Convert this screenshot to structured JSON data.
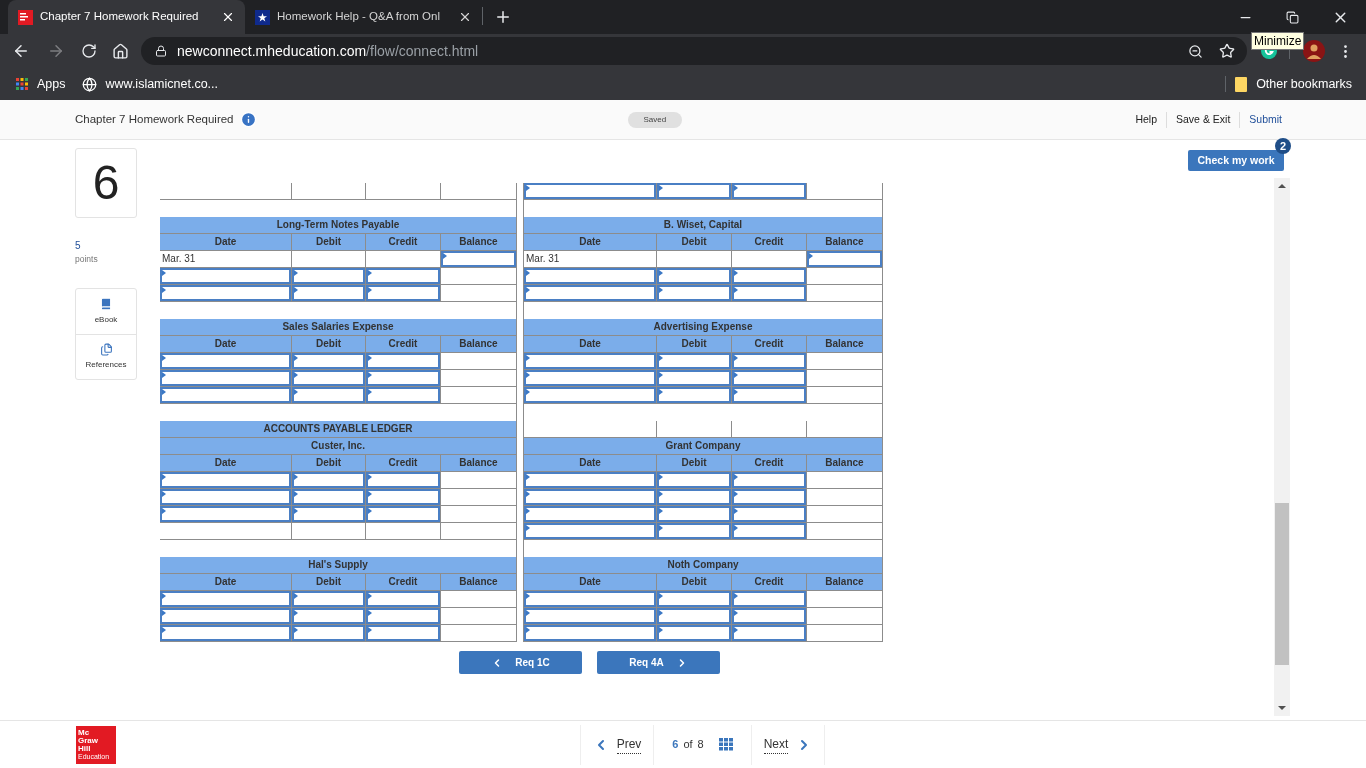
{
  "browser": {
    "tabs": [
      {
        "title": "Chapter 7 Homework Required",
        "selected": true,
        "kind": "mh"
      },
      {
        "title": "Homework Help - Q&A from Onl",
        "selected": false,
        "kind": "star"
      }
    ],
    "url_host": "newconnect.mheducation.com",
    "url_path": "/flow/connect.html",
    "bookmarks": [
      {
        "label": "Apps",
        "kind": "apps"
      },
      {
        "label": "www.islamicnet.co...",
        "kind": "globe"
      }
    ],
    "other_bookmarks": "Other bookmarks",
    "tooltip": "Minimize"
  },
  "header": {
    "title": "Chapter 7 Homework Required",
    "status": "Saved",
    "links": [
      {
        "label": "Help",
        "kind": "plain"
      },
      {
        "label": "Save & Exit",
        "kind": "plain"
      },
      {
        "label": "Submit",
        "kind": "primary"
      }
    ]
  },
  "question": {
    "number": "6",
    "points": "5",
    "points_label": "points",
    "tools": [
      {
        "label": "eBook",
        "kind": "book"
      },
      {
        "label": "References",
        "kind": "copy"
      }
    ]
  },
  "check_my_work": {
    "label": "Check my work",
    "badge": "2"
  },
  "ledger": {
    "left": [
      {
        "kind": "entry",
        "cells": [
          {
            "kind": "plain"
          },
          {
            "kind": "plain"
          },
          {
            "kind": "plain"
          },
          {
            "kind": "plain"
          }
        ]
      },
      {
        "kind": "gap"
      },
      {
        "kind": "title",
        "text": "Long-Term Notes Payable"
      },
      {
        "kind": "columns",
        "labels": [
          "Date",
          "Debit",
          "Credit",
          "Balance"
        ]
      },
      {
        "kind": "entry",
        "cells": [
          {
            "kind": "text",
            "text": "Mar. 31"
          },
          {
            "kind": "plain"
          },
          {
            "kind": "plain"
          },
          {
            "kind": "input"
          }
        ]
      },
      {
        "kind": "entry",
        "cells": [
          {
            "kind": "input"
          },
          {
            "kind": "input"
          },
          {
            "kind": "input"
          },
          {
            "kind": "plain"
          }
        ]
      },
      {
        "kind": "entry",
        "cells": [
          {
            "kind": "input"
          },
          {
            "kind": "input"
          },
          {
            "kind": "input"
          },
          {
            "kind": "plain"
          }
        ]
      },
      {
        "kind": "gap"
      },
      {
        "kind": "title",
        "text": "Sales Salaries Expense"
      },
      {
        "kind": "columns",
        "labels": [
          "Date",
          "Debit",
          "Credit",
          "Balance"
        ]
      },
      {
        "kind": "entry",
        "cells": [
          {
            "kind": "input"
          },
          {
            "kind": "input"
          },
          {
            "kind": "input"
          },
          {
            "kind": "plain"
          }
        ]
      },
      {
        "kind": "entry",
        "cells": [
          {
            "kind": "input"
          },
          {
            "kind": "input"
          },
          {
            "kind": "input"
          },
          {
            "kind": "plain"
          }
        ]
      },
      {
        "kind": "entry",
        "cells": [
          {
            "kind": "input"
          },
          {
            "kind": "input"
          },
          {
            "kind": "input"
          },
          {
            "kind": "plain"
          }
        ]
      },
      {
        "kind": "gap"
      },
      {
        "kind": "title",
        "text": "ACCOUNTS PAYABLE LEDGER"
      },
      {
        "kind": "title",
        "text": "Custer, Inc."
      },
      {
        "kind": "columns",
        "labels": [
          "Date",
          "Debit",
          "Credit",
          "Balance"
        ]
      },
      {
        "kind": "entry",
        "cells": [
          {
            "kind": "input"
          },
          {
            "kind": "input"
          },
          {
            "kind": "input"
          },
          {
            "kind": "plain"
          }
        ]
      },
      {
        "kind": "entry",
        "cells": [
          {
            "kind": "input"
          },
          {
            "kind": "input"
          },
          {
            "kind": "input"
          },
          {
            "kind": "plain"
          }
        ]
      },
      {
        "kind": "entry",
        "cells": [
          {
            "kind": "input"
          },
          {
            "kind": "input"
          },
          {
            "kind": "input"
          },
          {
            "kind": "plain"
          }
        ]
      },
      {
        "kind": "entry",
        "cells": [
          {
            "kind": "plain"
          },
          {
            "kind": "plain"
          },
          {
            "kind": "plain"
          },
          {
            "kind": "plain"
          }
        ]
      },
      {
        "kind": "gap"
      },
      {
        "kind": "title",
        "text": "Hal's Supply"
      },
      {
        "kind": "columns",
        "labels": [
          "Date",
          "Debit",
          "Credit",
          "Balance"
        ]
      },
      {
        "kind": "entry",
        "cells": [
          {
            "kind": "input"
          },
          {
            "kind": "input"
          },
          {
            "kind": "input"
          },
          {
            "kind": "plain"
          }
        ]
      },
      {
        "kind": "entry",
        "cells": [
          {
            "kind": "input"
          },
          {
            "kind": "input"
          },
          {
            "kind": "input"
          },
          {
            "kind": "plain"
          }
        ]
      },
      {
        "kind": "entry",
        "cells": [
          {
            "kind": "input"
          },
          {
            "kind": "input"
          },
          {
            "kind": "input"
          },
          {
            "kind": "plain"
          }
        ]
      }
    ],
    "right": [
      {
        "kind": "entry",
        "cells": [
          {
            "kind": "input"
          },
          {
            "kind": "input"
          },
          {
            "kind": "input"
          },
          {
            "kind": "plain"
          }
        ]
      },
      {
        "kind": "gap"
      },
      {
        "kind": "title",
        "text": "B. Wiset, Capital"
      },
      {
        "kind": "columns",
        "labels": [
          "Date",
          "Debit",
          "Credit",
          "Balance"
        ]
      },
      {
        "kind": "entry",
        "cells": [
          {
            "kind": "text",
            "text": "Mar. 31"
          },
          {
            "kind": "plain"
          },
          {
            "kind": "plain"
          },
          {
            "kind": "input"
          }
        ]
      },
      {
        "kind": "entry",
        "cells": [
          {
            "kind": "input"
          },
          {
            "kind": "input"
          },
          {
            "kind": "input"
          },
          {
            "kind": "plain"
          }
        ]
      },
      {
        "kind": "entry",
        "cells": [
          {
            "kind": "input"
          },
          {
            "kind": "input"
          },
          {
            "kind": "input"
          },
          {
            "kind": "plain"
          }
        ]
      },
      {
        "kind": "gap"
      },
      {
        "kind": "title",
        "text": "Advertising Expense"
      },
      {
        "kind": "columns",
        "labels": [
          "Date",
          "Debit",
          "Credit",
          "Balance"
        ]
      },
      {
        "kind": "entry",
        "cells": [
          {
            "kind": "input"
          },
          {
            "kind": "input"
          },
          {
            "kind": "input"
          },
          {
            "kind": "plain"
          }
        ]
      },
      {
        "kind": "entry",
        "cells": [
          {
            "kind": "input"
          },
          {
            "kind": "input"
          },
          {
            "kind": "input"
          },
          {
            "kind": "plain"
          }
        ]
      },
      {
        "kind": "entry",
        "cells": [
          {
            "kind": "input"
          },
          {
            "kind": "input"
          },
          {
            "kind": "input"
          },
          {
            "kind": "plain"
          }
        ]
      },
      {
        "kind": "gap"
      },
      {
        "kind": "entry",
        "cells": [
          {
            "kind": "plain"
          },
          {
            "kind": "plain"
          },
          {
            "kind": "plain"
          },
          {
            "kind": "plain"
          }
        ]
      },
      {
        "kind": "title",
        "text": "Grant Company"
      },
      {
        "kind": "columns",
        "labels": [
          "Date",
          "Debit",
          "Credit",
          "Balance"
        ]
      },
      {
        "kind": "entry",
        "cells": [
          {
            "kind": "input"
          },
          {
            "kind": "input"
          },
          {
            "kind": "input"
          },
          {
            "kind": "plain"
          }
        ]
      },
      {
        "kind": "entry",
        "cells": [
          {
            "kind": "input"
          },
          {
            "kind": "input"
          },
          {
            "kind": "input"
          },
          {
            "kind": "plain"
          }
        ]
      },
      {
        "kind": "entry",
        "cells": [
          {
            "kind": "input"
          },
          {
            "kind": "input"
          },
          {
            "kind": "input"
          },
          {
            "kind": "plain"
          }
        ]
      },
      {
        "kind": "entry",
        "cells": [
          {
            "kind": "input"
          },
          {
            "kind": "input"
          },
          {
            "kind": "input"
          },
          {
            "kind": "plain"
          }
        ]
      },
      {
        "kind": "gap"
      },
      {
        "kind": "title",
        "text": "Noth Company"
      },
      {
        "kind": "columns",
        "labels": [
          "Date",
          "Debit",
          "Credit",
          "Balance"
        ]
      },
      {
        "kind": "entry",
        "cells": [
          {
            "kind": "input"
          },
          {
            "kind": "input"
          },
          {
            "kind": "input"
          },
          {
            "kind": "plain"
          }
        ]
      },
      {
        "kind": "entry",
        "cells": [
          {
            "kind": "input"
          },
          {
            "kind": "input"
          },
          {
            "kind": "input"
          },
          {
            "kind": "plain"
          }
        ]
      },
      {
        "kind": "entry",
        "cells": [
          {
            "kind": "input"
          },
          {
            "kind": "input"
          },
          {
            "kind": "input"
          },
          {
            "kind": "plain"
          }
        ]
      }
    ]
  },
  "req_nav": [
    {
      "label": "Req 1C",
      "kind": "prev"
    },
    {
      "label": "Req 4A",
      "kind": "next"
    }
  ],
  "footer": {
    "logo": [
      "Mc",
      "Graw",
      "Hill",
      "Education"
    ],
    "prev": "Prev",
    "current": "6",
    "of": "of",
    "total": "8",
    "next": "Next"
  }
}
